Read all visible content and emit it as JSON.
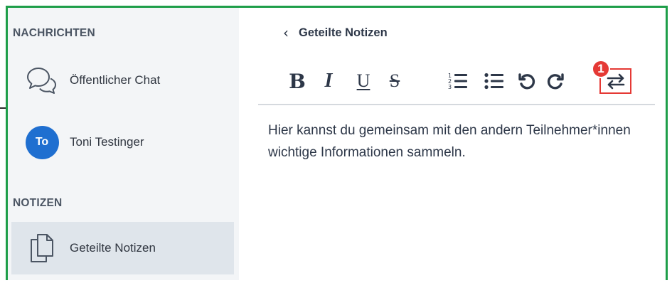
{
  "sidebar": {
    "chat_section_title": "NACHRICHTEN",
    "notes_section_title": "NOTIZEN",
    "items": [
      {
        "label": "Öffentlicher Chat",
        "icon": "chat-bubbles-icon"
      },
      {
        "label": "Toni Testinger",
        "avatar_initials": "To",
        "avatar_color": "#1f6fd0"
      },
      {
        "label": "Geteilte Notizen",
        "icon": "documents-icon",
        "active": true
      }
    ]
  },
  "notes_panel": {
    "back_label": "Geteilte Notizen",
    "toolbar": {
      "bold": "B",
      "italic": "I",
      "underline": "U",
      "strike": "S",
      "icons": [
        "ordered-list-icon",
        "bullet-list-icon",
        "undo-icon",
        "redo-icon",
        "swap-arrows-icon"
      ]
    },
    "annotation_number": "1",
    "content": "Hier kannst du gemeinsam mit den andern Teilnehmer*innen wichtige Informationen sammeln."
  },
  "colors": {
    "frame_border": "#1e9e49",
    "sidebar_bg": "#f3f5f7",
    "active_item_bg": "#dfe5eb",
    "highlight_red": "#e53935"
  }
}
